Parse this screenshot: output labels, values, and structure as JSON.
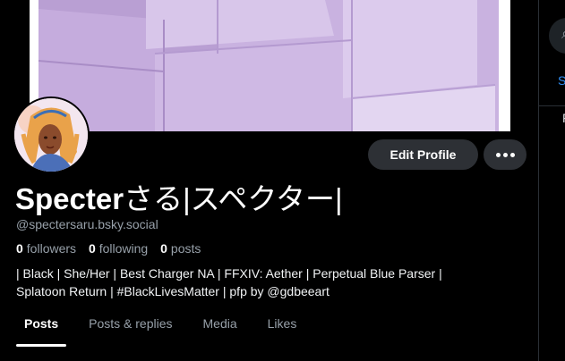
{
  "profile": {
    "display_name_latin": "Specter",
    "display_name_jp": "さる|スペクター|",
    "handle": "@spectersaru.bsky.social",
    "stats": {
      "followers_count": "0",
      "followers_label": "followers",
      "following_count": "0",
      "following_label": "following",
      "posts_count": "0",
      "posts_label": "posts"
    },
    "bio_line1": "| Black | She/Her | Best Charger NA | FFXIV: Aether | Perpetual Blue Parser |",
    "bio_line2": "Splatoon Return | #BlackLivesMatter | pfp by @gdbeeart"
  },
  "actions": {
    "edit_profile_label": "Edit Profile",
    "more_icon": "ellipsis-icon"
  },
  "tabs": [
    {
      "label": "Posts",
      "active": true
    },
    {
      "label": "Posts & replies",
      "active": false
    },
    {
      "label": "Media",
      "active": false
    },
    {
      "label": "Likes",
      "active": false
    }
  ],
  "right_panel": {
    "link_fragment": "S",
    "text_fragment": "F",
    "search_icon": "search-icon"
  },
  "colors": {
    "background": "#000000",
    "banner": "#c7afdf",
    "button_bg": "#2d3035",
    "muted_text": "#97a0a9",
    "link": "#2f8df5"
  }
}
